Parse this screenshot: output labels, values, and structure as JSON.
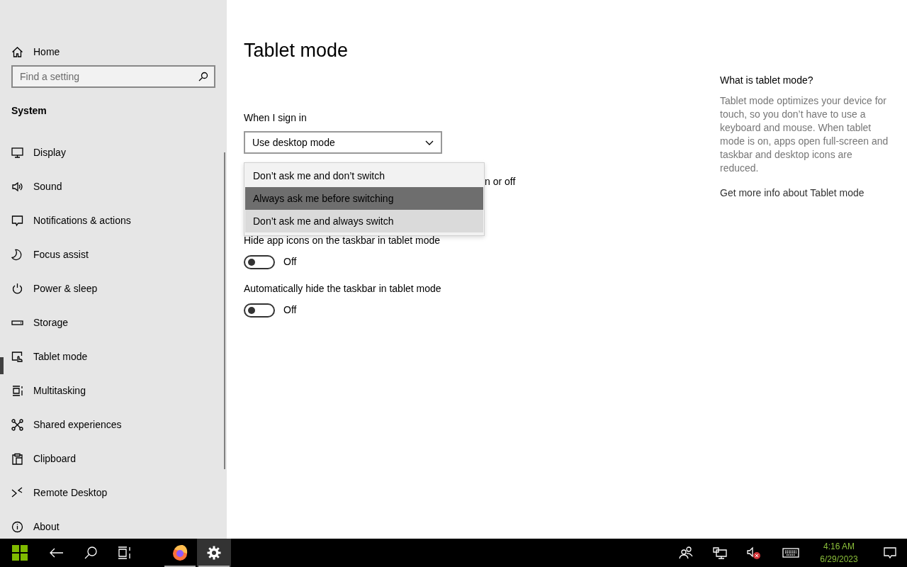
{
  "sidebar": {
    "home": "Home",
    "search": {
      "placeholder": "Find a setting"
    },
    "section": "System",
    "items": [
      {
        "label": "Display",
        "selected": false
      },
      {
        "label": "Sound",
        "selected": false
      },
      {
        "label": "Notifications & actions",
        "selected": false
      },
      {
        "label": "Focus assist",
        "selected": false
      },
      {
        "label": "Power & sleep",
        "selected": false
      },
      {
        "label": "Storage",
        "selected": false
      },
      {
        "label": "Tablet mode",
        "selected": true
      },
      {
        "label": "Multitasking",
        "selected": false
      },
      {
        "label": "Shared experiences",
        "selected": false
      },
      {
        "label": "Clipboard",
        "selected": false
      },
      {
        "label": "Remote Desktop",
        "selected": false
      },
      {
        "label": "About",
        "selected": false
      }
    ]
  },
  "page": {
    "title": "Tablet mode",
    "sign_in": {
      "label": "When I sign in",
      "value": "Use desktop mode"
    },
    "covered_label": "n or off",
    "dropdown": [
      {
        "label": "Don’t ask me and don’t switch",
        "selected": false,
        "hovered": false
      },
      {
        "label": "Always ask me before switching",
        "selected": true,
        "hovered": false
      },
      {
        "label": "Don’t ask me and always switch",
        "selected": false,
        "hovered": true
      }
    ],
    "toggles": [
      {
        "label": "Hide app icons on the taskbar in tablet mode",
        "on": false,
        "state": "Off"
      },
      {
        "label": "Automatically hide the taskbar in tablet mode",
        "on": false,
        "state": "Off"
      }
    ]
  },
  "help": {
    "title": "What is tablet mode?",
    "text": "Tablet mode optimizes your device for touch, so you don’t have to use a keyboard and mouse. When tablet mode is on, apps open full-screen and taskbar and desktop icons are reduced.",
    "link": "Get more info about Tablet mode"
  },
  "taskbar": {
    "apps": [
      {
        "running": true,
        "active": false
      },
      {
        "running": true,
        "active": true
      }
    ],
    "time": "4:16 AM",
    "date": "6/29/2023"
  }
}
